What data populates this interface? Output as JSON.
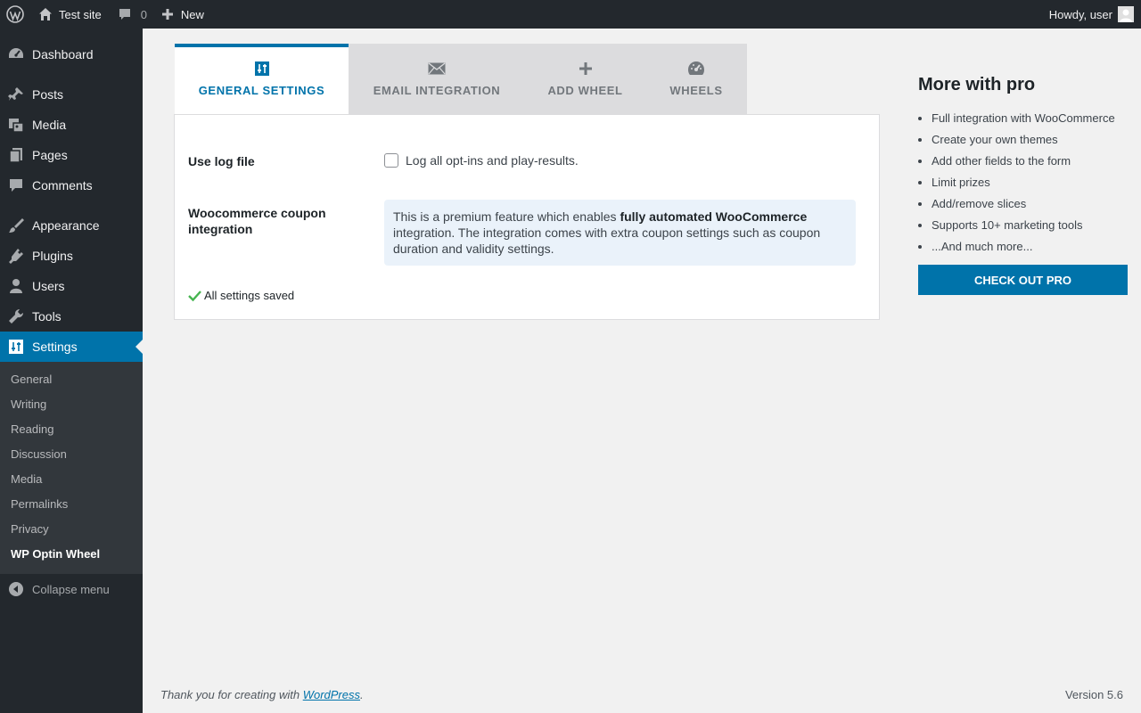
{
  "adminbar": {
    "site_name": "Test site",
    "comments_count": "0",
    "new_label": "New",
    "howdy": "Howdy, user"
  },
  "sidebar": {
    "items": [
      {
        "label": "Dashboard",
        "icon": "dashboard-icon"
      },
      {
        "label": "Posts",
        "icon": "pin-icon"
      },
      {
        "label": "Media",
        "icon": "media-icon"
      },
      {
        "label": "Pages",
        "icon": "pages-icon"
      },
      {
        "label": "Comments",
        "icon": "comment-icon"
      },
      {
        "label": "Appearance",
        "icon": "paintbrush-icon"
      },
      {
        "label": "Plugins",
        "icon": "plugin-icon"
      },
      {
        "label": "Users",
        "icon": "user-icon"
      },
      {
        "label": "Tools",
        "icon": "wrench-icon"
      },
      {
        "label": "Settings",
        "icon": "settings-icon"
      }
    ],
    "submenu": [
      "General",
      "Writing",
      "Reading",
      "Discussion",
      "Media",
      "Permalinks",
      "Privacy",
      "WP Optin Wheel"
    ],
    "collapse_label": "Collapse menu"
  },
  "tabs": [
    {
      "label": "GENERAL SETTINGS",
      "icon": "sliders-icon"
    },
    {
      "label": "EMAIL INTEGRATION",
      "icon": "envelope-icon"
    },
    {
      "label": "ADD WHEEL",
      "icon": "plus-icon"
    },
    {
      "label": "WHEELS",
      "icon": "gauge-icon"
    }
  ],
  "settings": {
    "log_label": "Use log file",
    "log_checkbox_text": "Log all opt-ins and play-results.",
    "woo_label": "Woocommerce coupon integration",
    "premium_text_1": "This is a premium feature which enables ",
    "premium_bold": "fully automated WooCommerce",
    "premium_text_2": " integration. The integration comes with extra coupon settings such as coupon duration and validity settings.",
    "saved_text": "All settings saved"
  },
  "pro": {
    "title": "More with pro",
    "features": [
      "Full integration with WooCommerce",
      "Create your own themes",
      "Add other fields to the form",
      "Limit prizes",
      "Add/remove slices",
      "Supports 10+ marketing tools",
      "...And much more..."
    ],
    "button_label": "CHECK OUT PRO"
  },
  "footer": {
    "thanks_prefix": "Thank you for creating with ",
    "link_text": "WordPress",
    "thanks_suffix": ".",
    "version": "Version 5.6"
  },
  "colors": {
    "accent": "#0073aa",
    "sidebar_bg": "#23282d",
    "submenu_bg": "#32373c",
    "success": "#46b450"
  }
}
